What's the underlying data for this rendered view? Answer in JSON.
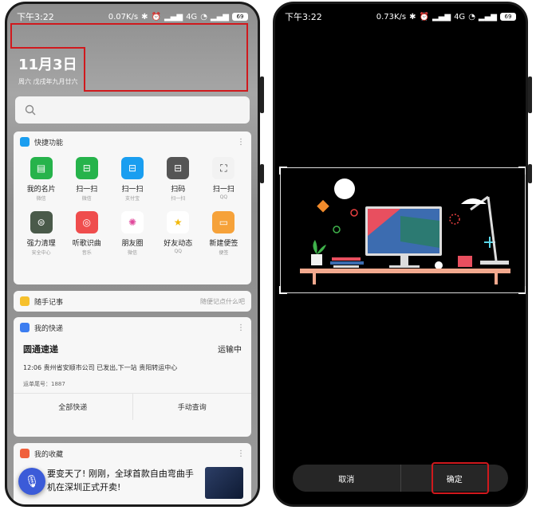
{
  "left_phone": {
    "status": {
      "time": "下午3:22",
      "speed": "0.07K/s",
      "network": "4G",
      "battery": "69"
    },
    "date": {
      "main": "11月3日",
      "sub": "周六 戊戌年九月廿六"
    },
    "quick_functions": {
      "title": "快捷功能",
      "items": [
        {
          "label": "我的名片",
          "sub": "微信",
          "icon": "card-icon",
          "color": "#26b34b"
        },
        {
          "label": "扫一扫",
          "sub": "微信",
          "icon": "scan-icon",
          "color": "#26b34b"
        },
        {
          "label": "扫一扫",
          "sub": "支付宝",
          "icon": "scan-icon",
          "color": "#1a9ef0"
        },
        {
          "label": "扫码",
          "sub": "扫一扫",
          "icon": "scan-icon",
          "color": "#555555"
        },
        {
          "label": "扫一扫",
          "sub": "QQ",
          "icon": "scan-frame-icon",
          "color": "#f2f2f2"
        },
        {
          "label": "强力清理",
          "sub": "安全中心",
          "icon": "cleaner-icon",
          "color": "#4a5a4a"
        },
        {
          "label": "听歌识曲",
          "sub": "音乐",
          "icon": "music-recognition-icon",
          "color": "#ef4d4d"
        },
        {
          "label": "朋友圈",
          "sub": "微信",
          "icon": "moments-icon",
          "color": "#ffffff"
        },
        {
          "label": "好友动态",
          "sub": "QQ",
          "icon": "star-icon",
          "color": "#ffffff"
        },
        {
          "label": "新建便签",
          "sub": "便签",
          "icon": "note-icon",
          "color": "#f6a23a"
        }
      ]
    },
    "memo": {
      "title": "随手记事",
      "hint": "随便记点什么吧"
    },
    "express": {
      "title": "我的快递",
      "company": "圆通速递",
      "state": "运输中",
      "detail": "12:06 贵州省安顺市公司 已发出,下一站 贵阳转运中心",
      "tracking_no": "运单尾号：1887",
      "btn_all": "全部快递",
      "btn_manual": "手动查询"
    },
    "favorites": {
      "title": "我的收藏",
      "text_line1": "要变天了! 刚刚，全球首款自由弯曲手",
      "text_line2": "机在深圳正式开卖!"
    }
  },
  "right_phone": {
    "status": {
      "time": "下午3:22",
      "speed": "0.73K/s",
      "network": "4G",
      "battery": "69"
    },
    "cancel": "取消",
    "confirm": "确定"
  },
  "colors": {
    "highlight": "#d0191d",
    "accent_blue": "#3b5bd8"
  }
}
